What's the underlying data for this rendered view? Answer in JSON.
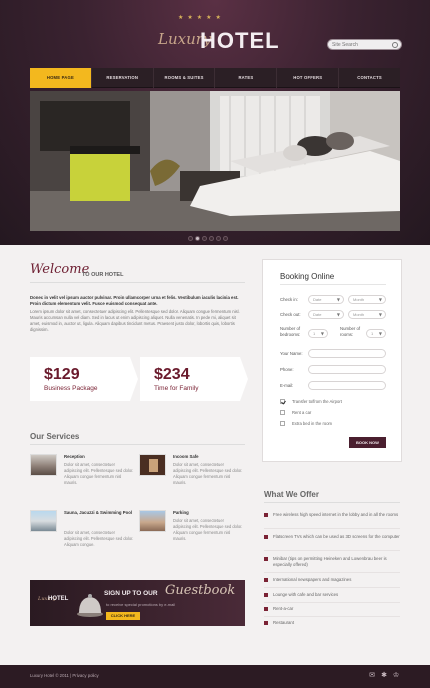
{
  "brand": {
    "script": "Luxury",
    "name": "HOTEL",
    "stars": "★★★★★"
  },
  "search": {
    "placeholder": "Site Search"
  },
  "nav": [
    "HOME PAGE",
    "RESERVATION",
    "ROOMS & SUITES",
    "RATES",
    "HOT OFFERS",
    "CONTACTS"
  ],
  "slider": {
    "dots": 6,
    "active": 1
  },
  "welcome": {
    "script": "Welcome",
    "title": "TO OUR HOTEL",
    "bold": "Donec in velit vel ipsum auctor pulvinar. Proin ullamcorper urna et felis. Vestibulum iaculis lacinia est. Proin dictum elementum velit. Fusce euismod consequat ante.",
    "text": "Lorem ipsum dolor sit amet, consectetuer adipiscing elit. Pellentesque sed dolor. Aliquam congue fermentum nisl. Mauris accumsan nulla vel diam. Sed in lacus ut enim adipiscing aliquet. Nulla venenatis. In pede mi, aliquet sit amet, euismod in, auctor ut, ligula. Aliquam dapibus tincidunt metus. Praesent justo dolor, lobortis quis, lobortis dignissim."
  },
  "promos": [
    {
      "price": "$129",
      "label": "Business Package"
    },
    {
      "price": "$234",
      "label": "Time for Family"
    }
  ],
  "services": {
    "title": "Our Services",
    "items": [
      {
        "title": "Reception",
        "desc": "Dolor sit amet, consectetuer adipiscing elit. Pellentesque sed dolor. Aliquam congue fermentum nisl mauris."
      },
      {
        "title": "Incoom Safe",
        "desc": "Dolor sit amet, consectetuer adipiscing elit. Pellentesque sed dolor. Aliquam congue fermentum nisl mauris."
      },
      {
        "title": "Sauna, Jacuzzi & Swimming Pool",
        "desc": "Dolor sit amet, consectetuer adipiscing elit. Pellentesque sed dolor. Aliquam congue."
      },
      {
        "title": "Parking",
        "desc": "Dolor sit amet, consectetuer adipiscing elit. Pellentesque sed dolor. Aliquam congue fermentum nisl mauris."
      }
    ]
  },
  "guestbook": {
    "logo_script": "Luxury",
    "logo_name": "HOTEL",
    "title": "SIGN UP TO OUR",
    "script": "Guestbook",
    "sub": "to receive special promotions by e-mail",
    "button": "CLICK HERE"
  },
  "booking": {
    "title": "Booking Online",
    "check_in": "Check in:",
    "check_out": "Check out:",
    "date_placeholder": "Date",
    "month_placeholder": "Month",
    "bedrooms": "Number of bedrooms:",
    "rooms": "Number of rooms:",
    "count_value": "1",
    "your_name": "Your Name:",
    "phone": "Phone:",
    "email": "E-mail:",
    "options": [
      {
        "label": "Transfer to/from the Airport",
        "checked": true
      },
      {
        "label": "Rent a car",
        "checked": false
      },
      {
        "label": "Extra bed in the room",
        "checked": false
      }
    ],
    "button": "BOOK NOW"
  },
  "offer": {
    "title": "What We Offer",
    "items": [
      "Free wireless high speed internet in the lobby and in all the rooms",
      "Flatscreen TVs which can be used as 3D screens for the computer",
      "Minibar (tips on permitting Heineken and Lowenbrau beer is especially offered)",
      "International newspapers and magazines",
      "Lounge with cafe and bar services",
      "Rent-a-car",
      "Restaurant"
    ]
  },
  "footer": {
    "text": "Luxury Hotel © 2011 | Privacy policy",
    "social": [
      "✉",
      "✱",
      "♔"
    ]
  },
  "colors": {
    "accent": "#f3b81e",
    "brand": "#6e2033",
    "dark": "#2c1b23"
  }
}
